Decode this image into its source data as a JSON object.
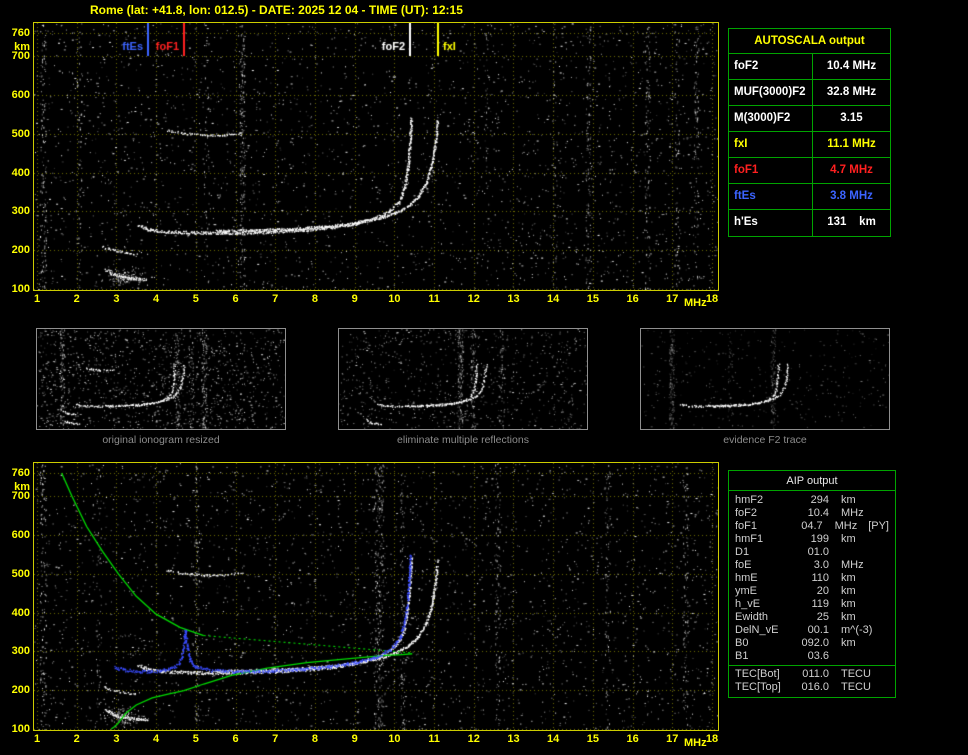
{
  "title": "Rome (lat: +41.8, lon: 012.5) - DATE: 2025 12 04 - TIME (UT): 12:15",
  "autoscala": {
    "header": "AUTOSCALA output",
    "rows": [
      {
        "label": "foF2",
        "value": "10.4 MHz",
        "color": "#ffffff"
      },
      {
        "label": "MUF(3000)F2",
        "value": "32.8 MHz",
        "color": "#ffffff"
      },
      {
        "label": "M(3000)F2",
        "value": "3.15",
        "color": "#ffffff"
      },
      {
        "label": "fxI",
        "value": "11.1 MHz",
        "color": "#ffff00"
      },
      {
        "label": "foF1",
        "value": "4.7 MHz",
        "color": "#ff2020"
      },
      {
        "label": "ftEs",
        "value": "3.8 MHz",
        "color": "#3c64ff"
      },
      {
        "label": "h'Es",
        "value": "131    km",
        "color": "#ffffff"
      }
    ]
  },
  "thumbnails": [
    {
      "caption": "original ionogram resized"
    },
    {
      "caption": "eliminate multiple reflections"
    },
    {
      "caption": "evidence F2 trace"
    }
  ],
  "aip": {
    "header": "AIP output",
    "rows": [
      {
        "label": "hmF2",
        "value": "294",
        "unit": "km",
        "note": ""
      },
      {
        "label": "foF2",
        "value": "10.4",
        "unit": "MHz",
        "note": ""
      },
      {
        "label": "foF1",
        "value": "04.7",
        "unit": "MHz",
        "note": "[PY]"
      },
      {
        "label": "hmF1",
        "value": "199",
        "unit": "km",
        "note": ""
      },
      {
        "label": "D1",
        "value": "01.0",
        "unit": "",
        "note": ""
      },
      {
        "label": "foE",
        "value": "3.0",
        "unit": "MHz",
        "note": ""
      },
      {
        "label": "hmE",
        "value": "110",
        "unit": "km",
        "note": ""
      },
      {
        "label": "ymE",
        "value": "20",
        "unit": "km",
        "note": ""
      },
      {
        "label": "h_vE",
        "value": "119",
        "unit": "km",
        "note": ""
      },
      {
        "label": "Ewidth",
        "value": "25",
        "unit": "km",
        "note": ""
      },
      {
        "label": "DelN_vE",
        "value": "00.1",
        "unit": "m^(-3)",
        "note": ""
      },
      {
        "label": "B0",
        "value": "092.0",
        "unit": "km",
        "note": ""
      },
      {
        "label": "B1",
        "value": "03.6",
        "unit": "",
        "note": ""
      }
    ],
    "tec_rows": [
      {
        "label": "TEC[Bot]",
        "value": "011.0",
        "unit": "TECU"
      },
      {
        "label": "TEC[Top]",
        "value": "016.0",
        "unit": "TECU"
      }
    ]
  },
  "chart_data": {
    "type": "scatter",
    "title": "Ionogram - Rome 2025 12 04 12:15 UT",
    "x_axis": {
      "label": "MHz",
      "min": 1,
      "max": 18,
      "ticks": [
        1,
        2,
        3,
        4,
        5,
        6,
        7,
        8,
        9,
        10,
        11,
        12,
        13,
        14,
        15,
        16,
        17,
        18
      ]
    },
    "y_axis": {
      "label": "km",
      "min": 100,
      "max": 760,
      "ticks": [
        760,
        700,
        600,
        500,
        400,
        300,
        200,
        100
      ]
    },
    "markers": [
      {
        "label": "ftEs",
        "freq_mhz": 3.8,
        "color": "#3c64ff",
        "label_side": "left"
      },
      {
        "label": "foF1",
        "freq_mhz": 4.7,
        "color": "#ff2020",
        "label_side": "left"
      },
      {
        "label": "foF2",
        "freq_mhz": 10.4,
        "color": "#ffffff",
        "label_side": "left"
      },
      {
        "label": "fxI",
        "freq_mhz": 11.1,
        "color": "#ffff00",
        "label_side": "right"
      }
    ],
    "traces": {
      "f_ordinary": [
        [
          3.55,
          265
        ],
        [
          3.8,
          254
        ],
        [
          4.2,
          249
        ],
        [
          5.0,
          246
        ],
        [
          6.0,
          246
        ],
        [
          7.0,
          249
        ],
        [
          7.8,
          254
        ],
        [
          8.5,
          261
        ],
        [
          9.0,
          270
        ],
        [
          9.5,
          283
        ],
        [
          9.85,
          300
        ],
        [
          10.1,
          325
        ],
        [
          10.25,
          360
        ],
        [
          10.33,
          410
        ],
        [
          10.38,
          465
        ],
        [
          10.42,
          540
        ]
      ],
      "f_extraordinary": [
        [
          5.5,
          250
        ],
        [
          6.5,
          252
        ],
        [
          7.5,
          256
        ],
        [
          8.3,
          262
        ],
        [
          9.0,
          271
        ],
        [
          9.6,
          283
        ],
        [
          10.0,
          296
        ],
        [
          10.35,
          315
        ],
        [
          10.6,
          340
        ],
        [
          10.8,
          375
        ],
        [
          10.95,
          425
        ],
        [
          11.03,
          480
        ],
        [
          11.08,
          535
        ]
      ],
      "es_low": [
        [
          2.72,
          152
        ],
        [
          2.9,
          140
        ],
        [
          3.1,
          132
        ],
        [
          3.35,
          128
        ],
        [
          3.6,
          126
        ],
        [
          3.75,
          126
        ]
      ],
      "es_mid": [
        [
          2.65,
          210
        ],
        [
          2.95,
          200
        ],
        [
          3.25,
          194
        ],
        [
          3.5,
          191
        ]
      ],
      "second_order": [
        [
          4.25,
          510
        ],
        [
          4.7,
          502
        ],
        [
          5.2,
          497
        ],
        [
          5.7,
          498
        ],
        [
          6.15,
          504
        ]
      ]
    },
    "profile_green": {
      "topside": [
        [
          1.62,
          760
        ],
        [
          1.88,
          700
        ],
        [
          2.25,
          622
        ],
        [
          2.65,
          558
        ],
        [
          3.05,
          500
        ],
        [
          3.5,
          442
        ],
        [
          4.0,
          396
        ],
        [
          4.6,
          362
        ],
        [
          5.2,
          341
        ]
      ],
      "topside_dotted": [
        [
          5.2,
          341
        ],
        [
          10.45,
          296
        ]
      ],
      "bottomside": [
        [
          2.87,
          100
        ],
        [
          2.95,
          106
        ],
        [
          3.02,
          112
        ],
        [
          3.1,
          122
        ],
        [
          3.25,
          142
        ],
        [
          3.5,
          162
        ],
        [
          3.9,
          180
        ],
        [
          4.3,
          190
        ],
        [
          4.7,
          199
        ],
        [
          5.2,
          216
        ],
        [
          5.9,
          238
        ],
        [
          6.8,
          257
        ],
        [
          7.8,
          271
        ],
        [
          8.8,
          281
        ],
        [
          9.7,
          289
        ],
        [
          10.2,
          292
        ],
        [
          10.45,
          294
        ]
      ]
    },
    "restored_trace_blue": [
      [
        2.95,
        260
      ],
      [
        3.2,
        253
      ],
      [
        3.6,
        249
      ],
      [
        4.0,
        250
      ],
      [
        4.3,
        255
      ],
      [
        4.55,
        266
      ],
      [
        4.65,
        290
      ],
      [
        4.7,
        330
      ],
      [
        4.73,
        353
      ],
      [
        4.78,
        310
      ],
      [
        4.85,
        278
      ],
      [
        5.0,
        260
      ],
      [
        5.4,
        252
      ],
      [
        6.0,
        249
      ],
      [
        6.8,
        250
      ],
      [
        7.6,
        255
      ],
      [
        8.4,
        262
      ],
      [
        9.0,
        272
      ],
      [
        9.5,
        285
      ],
      [
        9.9,
        305
      ],
      [
        10.15,
        338
      ],
      [
        10.28,
        390
      ],
      [
        10.35,
        455
      ],
      [
        10.4,
        548
      ]
    ]
  }
}
